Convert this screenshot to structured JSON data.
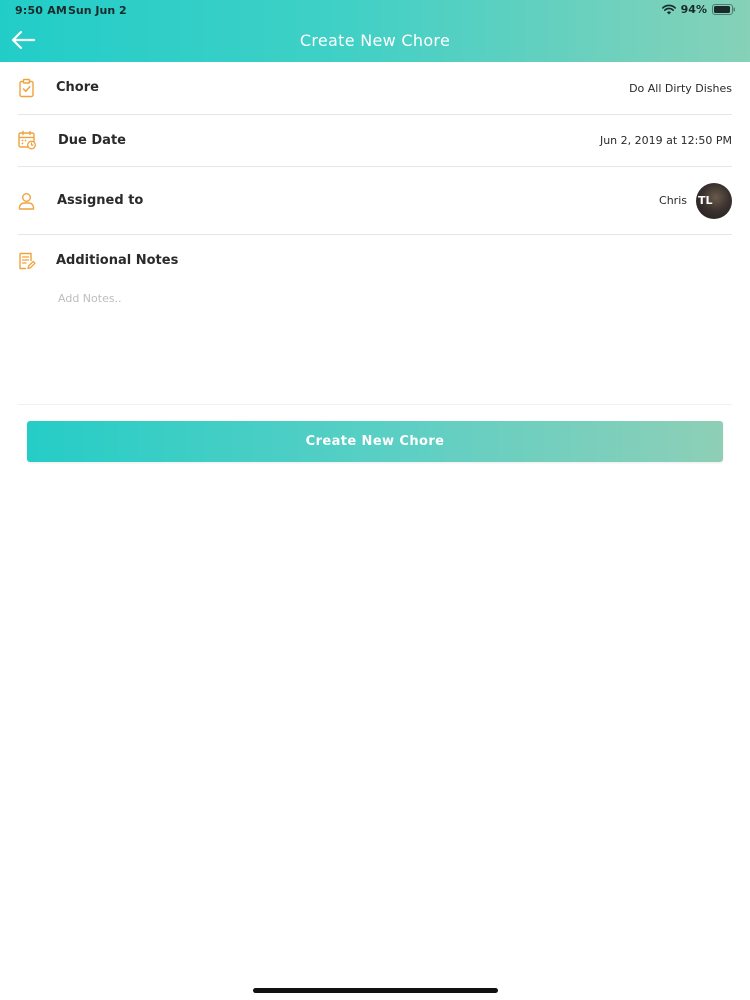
{
  "status_bar": {
    "time": "9:50 AM",
    "date": "Sun Jun 2",
    "battery": "94%",
    "battery_level": 0.94
  },
  "header": {
    "title": "Create New Chore",
    "back_icon": "arrow-left-icon"
  },
  "form": {
    "chore": {
      "label": "Chore",
      "value": "Do  All Dirty Dishes",
      "icon": "clipboard-check-icon"
    },
    "due_date": {
      "label": "Due Date",
      "value": "Jun 2, 2019 at 12:50 PM",
      "icon": "calendar-clock-icon"
    },
    "assigned_to": {
      "label": "Assigned to",
      "value": "Chris",
      "avatar_initials": "TL",
      "icon": "user-icon"
    },
    "notes": {
      "label": "Additional Notes",
      "placeholder": "Add Notes..",
      "value": "",
      "icon": "note-edit-icon"
    }
  },
  "actions": {
    "create_label": "Create New Chore"
  },
  "colors": {
    "accent_start": "#22cdc8",
    "accent_end": "#86d1b8",
    "icon_orange": "#f0a23c"
  }
}
